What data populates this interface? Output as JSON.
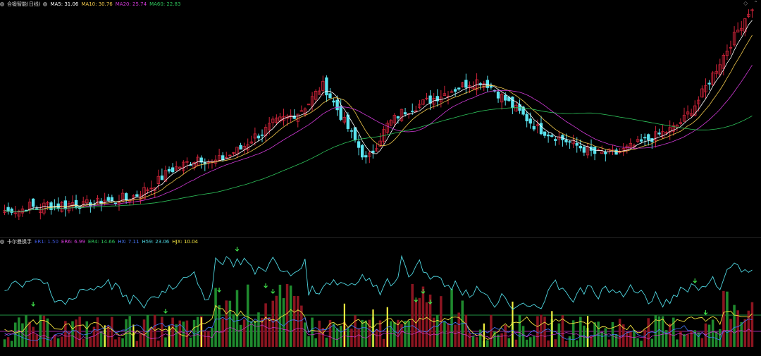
{
  "main_panel": {
    "title": "合锻智能(日线)",
    "indicators": [
      {
        "label": "MA5: 31.06",
        "color": "#ffffff"
      },
      {
        "label": "MA10: 30.76",
        "color": "#f2c94c"
      },
      {
        "label": "MA20: 25.74",
        "color": "#d23ad8"
      },
      {
        "label": "MA60: 22.83",
        "color": "#2ec45b"
      }
    ]
  },
  "sub_panel": {
    "title": "卡尔曼换手",
    "indicators": [
      {
        "label": "ER1: 1.50",
        "color": "#3d56d8"
      },
      {
        "label": "ER6: 6.99",
        "color": "#d23ad8"
      },
      {
        "label": "ER4: 14.66",
        "color": "#2ec45b"
      },
      {
        "label": "HX: 7.11",
        "color": "#4a7bff"
      },
      {
        "label": "H59: 23.06",
        "color": "#4fd6e0"
      },
      {
        "label": "HJX: 10.04",
        "color": "#f2e340"
      }
    ]
  },
  "icons": {
    "left": "diamond-icon",
    "right": "chevron-up-icon"
  },
  "colors": {
    "up": "#d2243a",
    "down": "#5ae3ef",
    "vol_up": "#8b1520",
    "vol_down": "#1f8a2e",
    "signal": "#f2f040"
  },
  "chart_data": [
    {
      "type": "candlestick",
      "y_trend": [
        14,
        13,
        15,
        14,
        14,
        15,
        16,
        17,
        16,
        15,
        16,
        17,
        18,
        17,
        16,
        17,
        18,
        17,
        18,
        19,
        18,
        18,
        17,
        18,
        19,
        18,
        19,
        20,
        21,
        20,
        19,
        20,
        21,
        22,
        21,
        22,
        23,
        24,
        26,
        27,
        28,
        29,
        31,
        33,
        35,
        37,
        39,
        40,
        41,
        42,
        43,
        44,
        45,
        46,
        48,
        47,
        46,
        45,
        44,
        45,
        46,
        47,
        48,
        49,
        51,
        52,
        53,
        55,
        57,
        59,
        61,
        62,
        63,
        65,
        67,
        69,
        70,
        71,
        72,
        73,
        74,
        75,
        76,
        78,
        80,
        82,
        85,
        88,
        91,
        93,
        90,
        86,
        82,
        78,
        74,
        70,
        66,
        62,
        58,
        54,
        50,
        46,
        48,
        52,
        56,
        60,
        64,
        68,
        70,
        72,
        74,
        76,
        77,
        78,
        79,
        80,
        81,
        82,
        83,
        84,
        85,
        86,
        87,
        88,
        89,
        90,
        91,
        92,
        93,
        94,
        95,
        95,
        96,
        96,
        95,
        94,
        92,
        90,
        88,
        86,
        84,
        82,
        80,
        78,
        76,
        74,
        72,
        70,
        68,
        66,
        65,
        64,
        63,
        62,
        61,
        60,
        59,
        58,
        57,
        56,
        55,
        54,
        53,
        52,
        51,
        50,
        50,
        50,
        50,
        50,
        50,
        50,
        51,
        52,
        53,
        54,
        55,
        56,
        57,
        58,
        59,
        60,
        61,
        62,
        63,
        64,
        65,
        66,
        68,
        70,
        72,
        75,
        78,
        81,
        84,
        88,
        92,
        96,
        100,
        104,
        108,
        112,
        116,
        120,
        124,
        128,
        132,
        136,
        140
      ]
    }
  ]
}
